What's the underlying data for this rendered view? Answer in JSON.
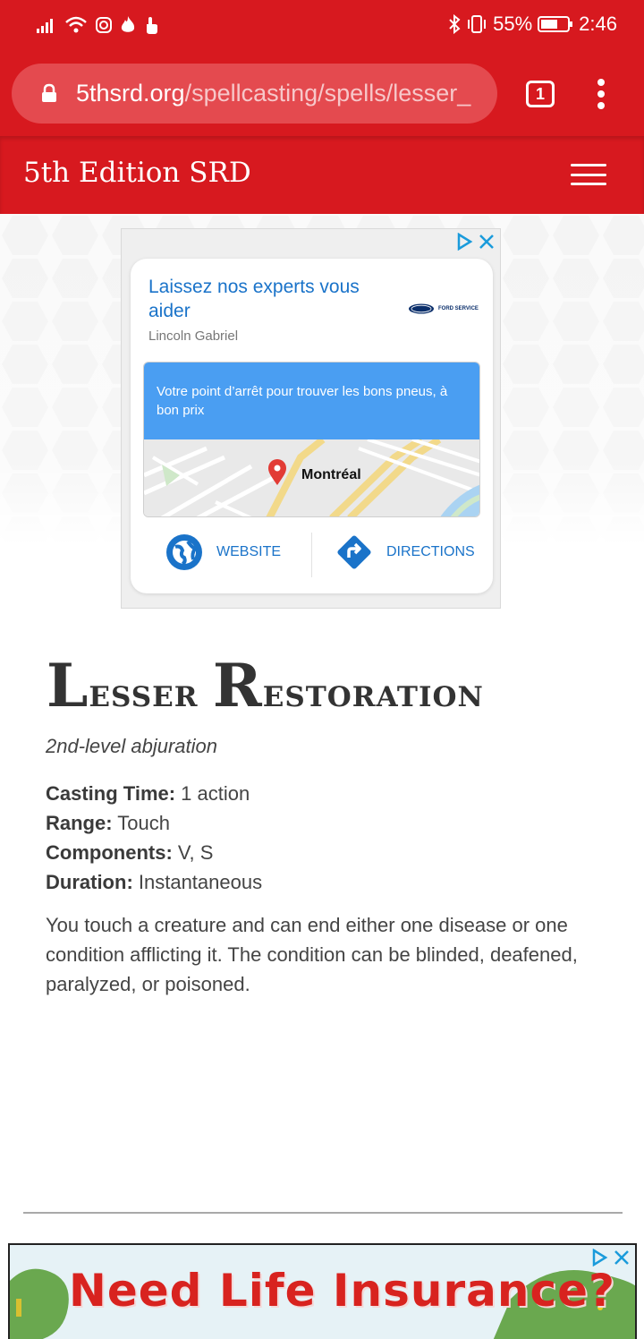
{
  "status_bar": {
    "battery": "55%",
    "time": "2:46"
  },
  "browser": {
    "url_domain": "5thsrd.org",
    "url_path": "/spellcasting/spells/lesser_",
    "tab_count": "1"
  },
  "site": {
    "title": "5th Edition SRD"
  },
  "ad_top": {
    "headline": "Laissez nos experts vous aider",
    "brand_text": "FORD SERVICE",
    "advertiser": "Lincoln Gabriel",
    "banner_text": "Votre point d’arrêt pour trouver les bons pneus, à bon prix",
    "map_label": "Montréal",
    "website_label": "WEBSITE",
    "directions_label": "DIRECTIONS"
  },
  "spell": {
    "title_first_cap": "L",
    "title_first_rest": "esser",
    "title_second_cap": "R",
    "title_second_rest": "estoration",
    "type": "2nd-level abjuration",
    "casting_time_label": "Casting Time:",
    "casting_time_value": " 1 action",
    "range_label": "Range:",
    "range_value": " Touch",
    "components_label": "Components:",
    "components_value": " V, S",
    "duration_label": "Duration:",
    "duration_value": " Instantaneous",
    "description": "You touch a creature and can end either one disease or one condition afflicting it. The condition can be blinded, deafened, paralyzed, or poisoned."
  },
  "ad_bottom": {
    "text": "Need Life Insurance?"
  },
  "colors": {
    "brand_red": "#d7191f",
    "ad_blue": "#1a73c9"
  }
}
